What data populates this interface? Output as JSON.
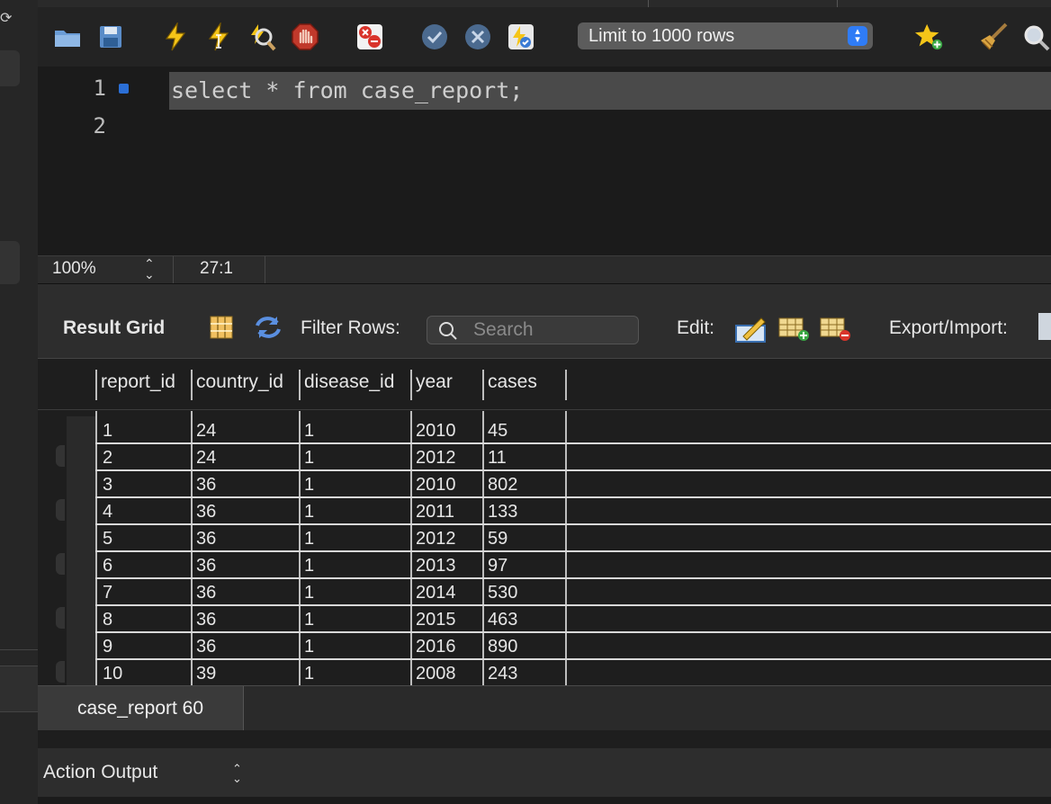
{
  "toolbar": {
    "limit_select": "Limit to 1000 rows",
    "icons": [
      "open-folder-icon",
      "save-icon",
      "execute-icon",
      "execute-current-icon",
      "explain-icon",
      "stop-icon",
      "toggle-error-icon",
      "commit-icon",
      "rollback-icon",
      "autocommit-icon",
      "bookmark-icon",
      "beautify-icon",
      "find-icon"
    ]
  },
  "editor": {
    "line_numbers": [
      "1",
      "2"
    ],
    "code": "select * from case_report;"
  },
  "status": {
    "zoom": "100%",
    "cursor_position": "27:1"
  },
  "result_toolbar": {
    "result_grid_label": "Result Grid",
    "filter_rows_label": "Filter Rows:",
    "search_placeholder": "Search",
    "edit_label": "Edit:",
    "export_import_label": "Export/Import:"
  },
  "grid": {
    "columns": [
      "report_id",
      "country_id",
      "disease_id",
      "year",
      "cases"
    ],
    "rows": [
      [
        "1",
        "24",
        "1",
        "2010",
        "45"
      ],
      [
        "2",
        "24",
        "1",
        "2012",
        "11"
      ],
      [
        "3",
        "36",
        "1",
        "2010",
        "802"
      ],
      [
        "4",
        "36",
        "1",
        "2011",
        "133"
      ],
      [
        "5",
        "36",
        "1",
        "2012",
        "59"
      ],
      [
        "6",
        "36",
        "1",
        "2013",
        "97"
      ],
      [
        "7",
        "36",
        "1",
        "2014",
        "530"
      ],
      [
        "8",
        "36",
        "1",
        "2015",
        "463"
      ],
      [
        "9",
        "36",
        "1",
        "2016",
        "890"
      ],
      [
        "10",
        "39",
        "1",
        "2008",
        "243"
      ]
    ]
  },
  "result_tabs": [
    "case_report 60"
  ],
  "output_panel": {
    "selector": "Action Output"
  },
  "colors": {
    "accent": "#2f7cf6",
    "background": "#1e1e1e"
  }
}
